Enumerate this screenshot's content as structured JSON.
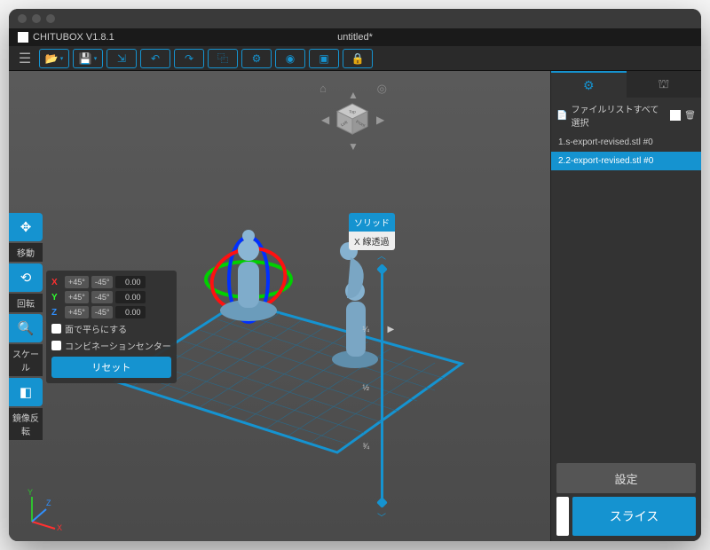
{
  "app": {
    "name": "CHITUBOX V1.8.1",
    "doc_title": "untitled*"
  },
  "toolbar": {
    "items": [
      "open",
      "save",
      "import",
      "undo",
      "redo",
      "copy",
      "repair",
      "hollow",
      "support",
      "screenshot",
      "lock"
    ]
  },
  "left_tools": {
    "move": "移動",
    "rotate": "回転",
    "scale": "スケール",
    "mirror": "鏡像反転"
  },
  "rotate_panel": {
    "axes": [
      {
        "axis": "X",
        "plus": "+45°",
        "minus": "-45°",
        "val": "0.00"
      },
      {
        "axis": "Y",
        "plus": "+45°",
        "minus": "-45°",
        "val": "0.00"
      },
      {
        "axis": "Z",
        "plus": "+45°",
        "minus": "-45°",
        "val": "0.00"
      }
    ],
    "flatten": "面で平らにする",
    "combination": "コンビネーションセンター",
    "reset": "リセット"
  },
  "render_mode": {
    "solid": "ソリッド",
    "xray": "X 線透過"
  },
  "layer_ticks": [
    "¼",
    "½",
    "¾"
  ],
  "right": {
    "file_header": "ファイルリストすべて選択",
    "files": [
      "1.s-export-revised.stl #0",
      "2.2-export-revised.stl #0"
    ],
    "settings": "設定",
    "slice": "スライス"
  },
  "cube": {
    "top": "Top",
    "left": "Left",
    "front": "Front"
  }
}
